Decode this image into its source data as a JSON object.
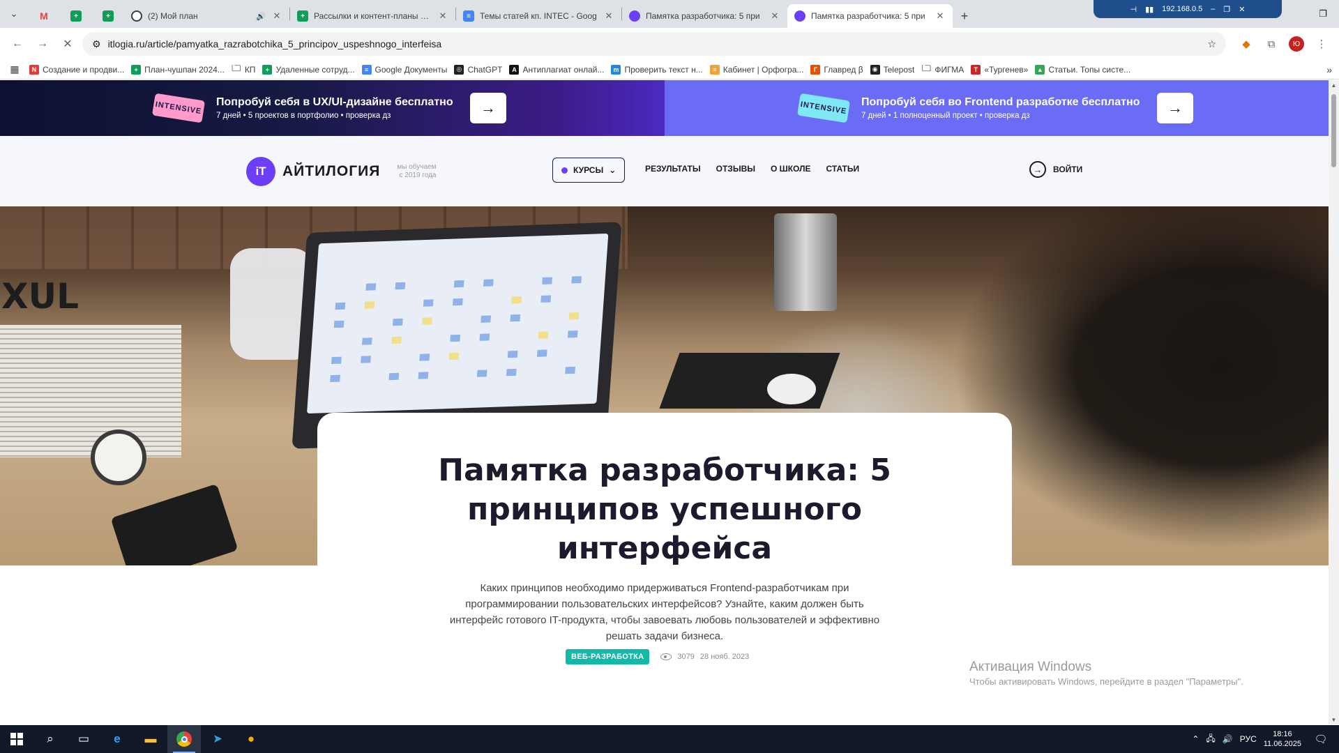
{
  "browser": {
    "tabs": [
      {
        "label": "",
        "icon": "chevron-down-icon",
        "type": "menu"
      },
      {
        "label": "",
        "icon": "gmail-icon",
        "type": "pinned"
      },
      {
        "label": "",
        "icon": "sheets-icon",
        "type": "pinned"
      },
      {
        "label": "",
        "icon": "sheets-icon",
        "type": "pinned"
      },
      {
        "label": "(2) Мой план",
        "icon": "circle-arrow-icon",
        "type": "normal",
        "audio": true
      },
      {
        "label": "Рассылки и контент-планы ПА",
        "icon": "sheets-icon",
        "type": "normal"
      },
      {
        "label": "Темы статей кп. INTEC - Goog",
        "icon": "docs-icon",
        "type": "normal"
      },
      {
        "label": "Памятка разработчика: 5 при",
        "icon": "itlogia-icon",
        "type": "normal"
      },
      {
        "label": "Памятка разработчика: 5 при",
        "icon": "itlogia-icon",
        "type": "active"
      }
    ],
    "new_tab": "+",
    "network_ip": "192.168.0.5",
    "url": "itlogia.ru/article/pamyatka_razrabotchika_5_principov_uspeshnogo_interfeisa",
    "bookmarks": [
      {
        "label": "Создание и продви...",
        "color": "#e53935",
        "letter": "N"
      },
      {
        "label": "План-чушпан 2024...",
        "color": "#0f9d58",
        "letter": "+"
      },
      {
        "label": "КП",
        "color": "",
        "letter": "folder"
      },
      {
        "label": "Удаленные сотруд...",
        "color": "#0f9d58",
        "letter": "+"
      },
      {
        "label": "Google Документы",
        "color": "#4285f4",
        "letter": "≡"
      },
      {
        "label": "ChatGPT",
        "color": "#202124",
        "letter": "◎"
      },
      {
        "label": "Антиплагиат онлай...",
        "color": "#111111",
        "letter": "A"
      },
      {
        "label": "Проверить текст н...",
        "color": "#1e88e5",
        "letter": "m"
      },
      {
        "label": "Кабинет | Орфогра...",
        "color": "#f4a236",
        "letter": "≡"
      },
      {
        "label": "Главред β",
        "color": "#e65100",
        "letter": "Г"
      },
      {
        "label": "Telepost",
        "color": "#222222",
        "letter": "◉"
      },
      {
        "label": "ФИГМА",
        "color": "",
        "letter": "folder"
      },
      {
        "label": "«Тургенев»",
        "color": "#c62828",
        "letter": "T"
      },
      {
        "label": "Статьи. Топы систе...",
        "color": "#34a853",
        "letter": "▲"
      }
    ]
  },
  "promos": [
    {
      "sticker": "INTENSIVE",
      "title": "Попробуй себя в UX/UI-дизайне бесплатно",
      "subtitle": "7 дней  •  5 проектов в портфолио  •  проверка дз"
    },
    {
      "sticker": "INTENSIVE",
      "title": "Попробуй себя во Frontend разработке бесплатно",
      "subtitle": "7 дней  •  1 полноценный проект  •  проверка дз"
    }
  ],
  "site": {
    "logo_mark": "iT",
    "logo_name": "АЙТИЛОГИЯ",
    "logo_tagline_1": "мы обучаем",
    "logo_tagline_2": "с 2019 года",
    "courses": "КУРСЫ",
    "nav": [
      "РЕЗУЛЬТАТЫ",
      "ОТЗЫВЫ",
      "О ШКОЛЕ",
      "СТАТЬИ"
    ],
    "login": "ВОЙТИ"
  },
  "hero": {
    "ghost_text": "XUL"
  },
  "article": {
    "title": "Памятка разработчика: 5 принципов успешного интерфейса",
    "lead": "Каких принципов необходимо придерживаться Frontend-разработчикам при программировании пользовательских интерфейсов? Узнайте, каким должен быть интерфейс готового IT-продукта, чтобы завоевать любовь пользователей и эффективно решать задачи бизнеса.",
    "tag": "ВЕБ-РАЗРАБОТКА",
    "views": "3079",
    "date": "28 нояб. 2023"
  },
  "watermark": {
    "title": "Активация Windows",
    "subtitle": "Чтобы активировать Windows, перейдите в раздел \"Параметры\"."
  },
  "taskbar": {
    "language": "РУС",
    "time": "18:16",
    "date": "11.06.2025"
  }
}
